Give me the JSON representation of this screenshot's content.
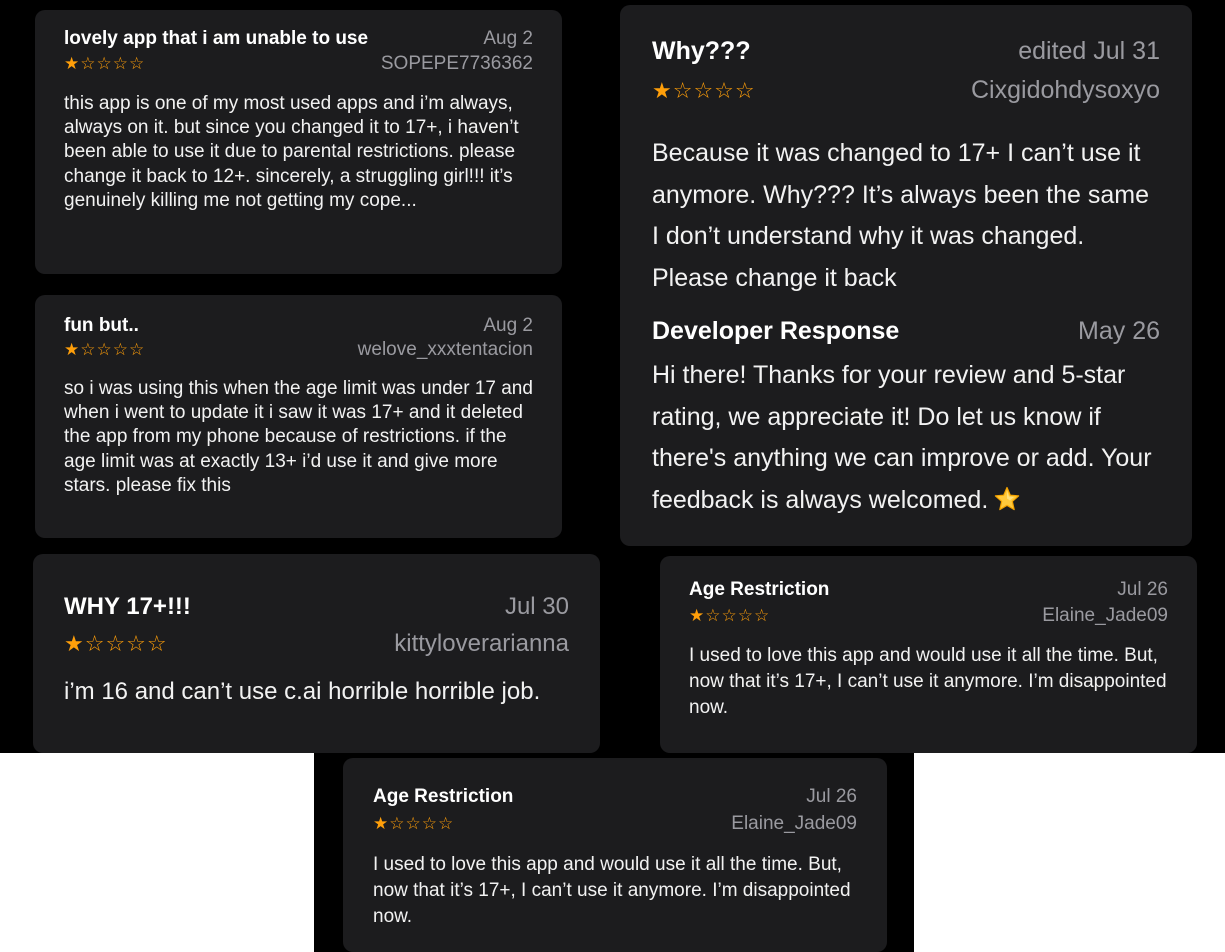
{
  "colors": {
    "background": "#000000",
    "card": "#1c1c1e",
    "star": "#ff9f0a",
    "secondary_text": "#9a9aa0",
    "primary_text": "#ffffff"
  },
  "reviews": [
    {
      "title": "lovely app that i am unable to use",
      "date": "Aug 2",
      "author": "SOPEPE7736362",
      "rating": 1,
      "stars": "★☆☆☆☆",
      "body": "this app is one of my most used apps and i’m always, always on it. but since you changed it to 17+, i haven’t been able to use it due to parental restrictions. please change it back to 12+. sincerely, a struggling girl!!! it’s genuinely killing me not getting my cope..."
    },
    {
      "title": "fun but..",
      "date": "Aug 2",
      "author": "welove_xxxtentacion",
      "rating": 1,
      "stars": "★☆☆☆☆",
      "body": "so i was using this when the age limit was under 17 and when i went to update it i saw it was 17+ and it deleted the app from my phone because of restrictions. if the age limit was at exactly 13+ i’d use it and give more stars. please fix this"
    },
    {
      "title": "Why???",
      "date": "edited Jul 31",
      "author": "Cixgidohdysoxyo",
      "rating": 1,
      "stars": "★☆☆☆☆",
      "body": "Because it was changed to 17+ I can’t use it anymore. Why??? It’s always been the same I don’t understand why it was changed. Please change it back",
      "developer_response": {
        "title": "Developer Response",
        "date": "May 26",
        "body": "Hi there! Thanks for your review and 5-star rating, we appreciate it! Do let us know if there's anything we can improve or add. Your feedback is always welcomed.",
        "emoji": "star-emoji"
      }
    },
    {
      "title": "WHY 17+!!!",
      "date": "Jul 30",
      "author": "kittyloverarianna",
      "rating": 1,
      "stars": "★☆☆☆☆",
      "body": "i’m 16 and can’t use c.ai horrible horrible job."
    },
    {
      "title": "Age Restriction",
      "date": "Jul 26",
      "author": "Elaine_Jade09",
      "rating": 1,
      "stars": "★☆☆☆☆",
      "body": "I used to love this app and would use it all the time. But, now that it’s 17+, I can’t use it anymore. I’m disappointed now."
    },
    {
      "title": "Age Restriction",
      "date": "Jul 26",
      "author": "Elaine_Jade09",
      "rating": 1,
      "stars": "★☆☆☆☆",
      "body": "I used to love this app and would use it all the time. But, now that it’s 17+, I can’t use it anymore. I’m disappointed now."
    }
  ]
}
